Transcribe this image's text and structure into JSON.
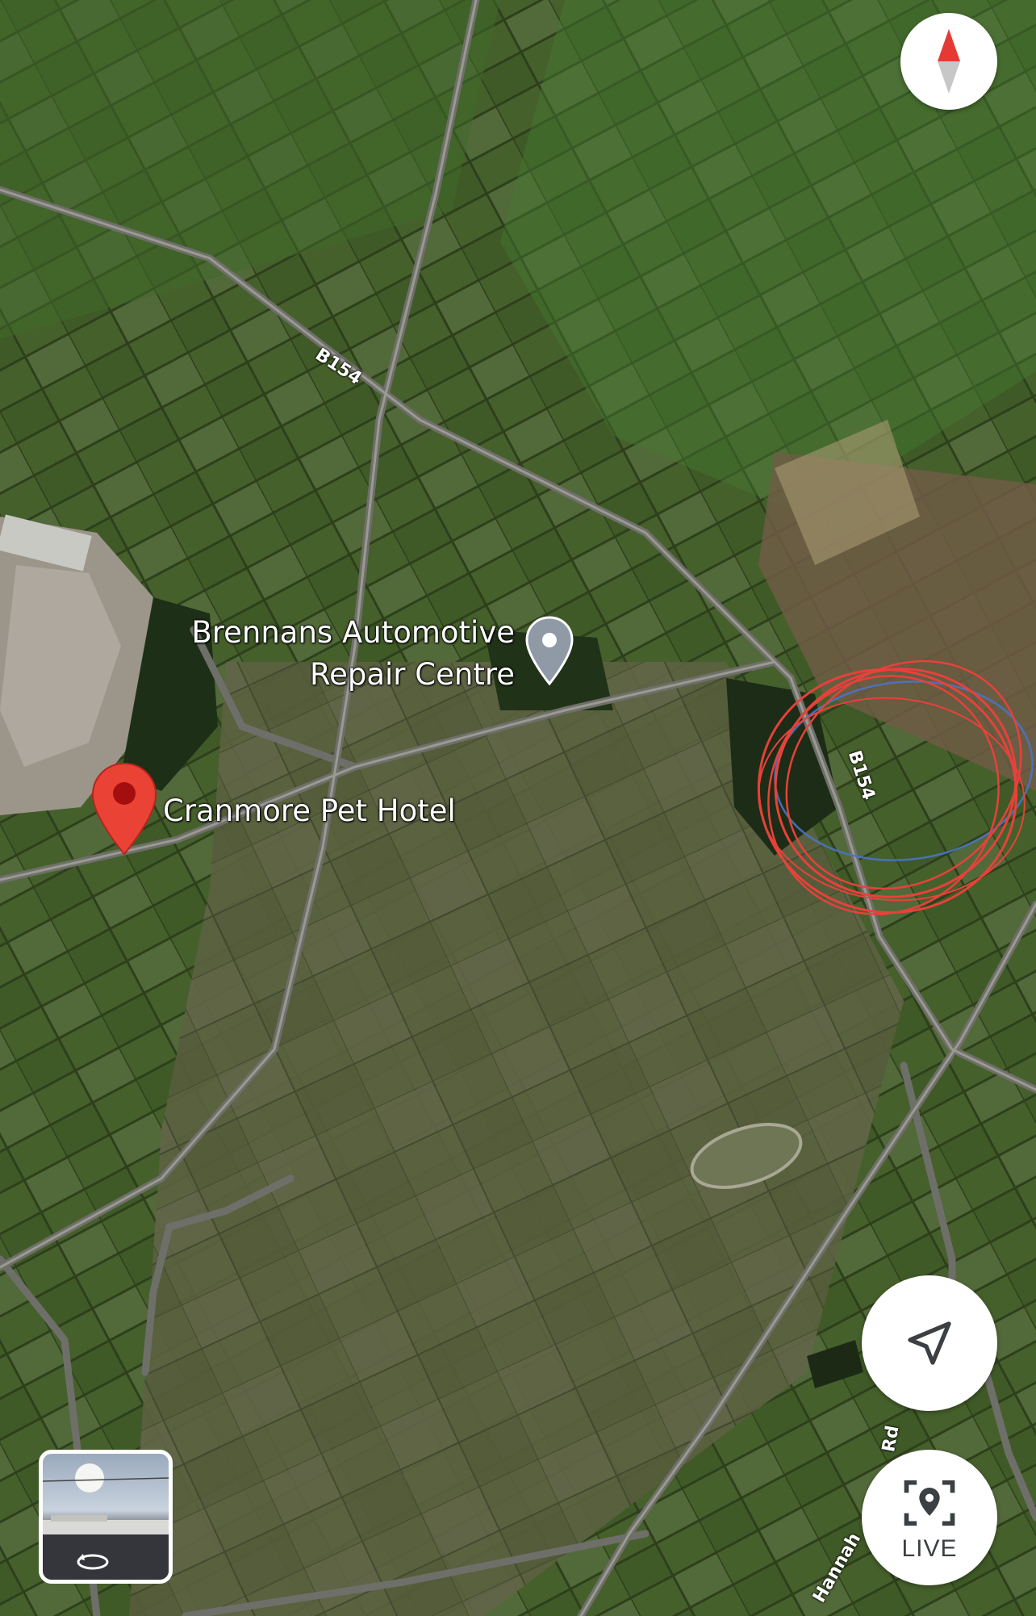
{
  "map": {
    "type": "satellite",
    "places": [
      {
        "name_line1": "Brennans Automotive",
        "name_line2": "Repair Centre",
        "pin": "gray-place-pin-icon"
      },
      {
        "name": "Cranmore Pet Hotel",
        "pin": "red-selected-pin-icon"
      }
    ],
    "roads": [
      "B154",
      "B154",
      "Hannah... Rd"
    ],
    "road_labels": {
      "b154_upper": "B154",
      "b154_lower": "B154",
      "hannahs_rd": "Hannah"
    },
    "road_labels_extra": {
      "hannahs_rd_tail": "Rd"
    },
    "annotation": {
      "shape": "scribbled-circle",
      "colors": [
        "#e8413a",
        "#4a73c9"
      ]
    }
  },
  "controls": {
    "compass": {
      "icon": "compass-icon",
      "needle_color": "#e53935"
    },
    "location_button": {
      "icon": "navigation-arrow-icon"
    },
    "live_button": {
      "icon": "live-view-pin-icon",
      "label": "LIVE"
    },
    "streetview": {
      "icon": "rotate-360-icon"
    }
  }
}
